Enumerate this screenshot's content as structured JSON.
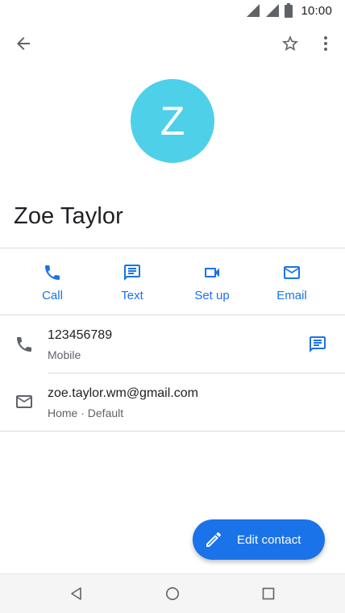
{
  "status_bar": {
    "time": "10:00"
  },
  "contact": {
    "initial": "Z",
    "name": "Zoe Taylor"
  },
  "actions": [
    {
      "label": "Call",
      "icon": "phone-icon"
    },
    {
      "label": "Text",
      "icon": "message-icon"
    },
    {
      "label": "Set up",
      "icon": "video-icon"
    },
    {
      "label": "Email",
      "icon": "email-icon"
    }
  ],
  "details": [
    {
      "primary": "123456789",
      "secondary": "Mobile",
      "icon": "phone-icon",
      "end_icon": "message-icon"
    },
    {
      "primary": "zoe.taylor.wm@gmail.com",
      "secondary": "Home · Default",
      "icon": "email-icon"
    }
  ],
  "fab": {
    "label": "Edit contact",
    "icon": "pencil-icon"
  },
  "colors": {
    "accent": "#1a73e8",
    "avatar": "#4fd0e9",
    "icon_gray": "#5f6368",
    "divider": "#dadce0"
  }
}
